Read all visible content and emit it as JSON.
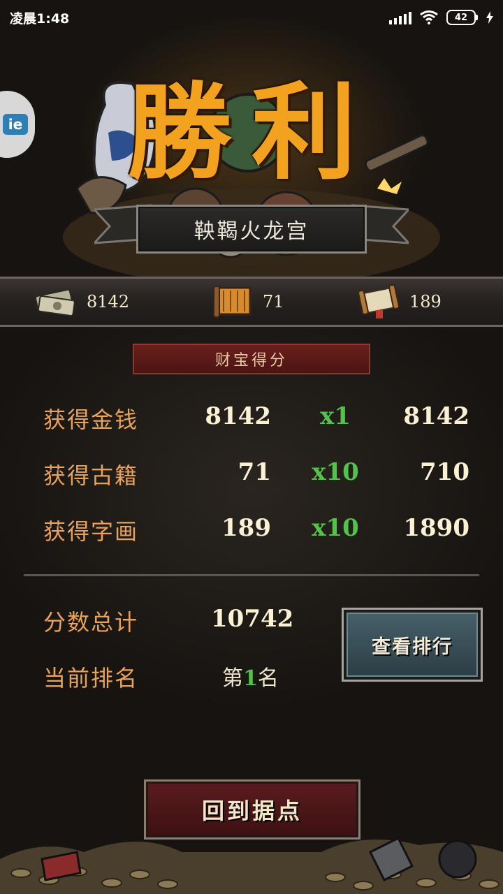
{
  "status_bar": {
    "time": "凌晨1:48",
    "battery": "42"
  },
  "side_float": {
    "glyph": "ie"
  },
  "header": {
    "title": "勝利",
    "stage_name": "鞅鞨火龙宫"
  },
  "resources": [
    {
      "icon": "money-icon",
      "value": "8142"
    },
    {
      "icon": "book-icon",
      "value": "71"
    },
    {
      "icon": "scroll-icon",
      "value": "189"
    }
  ],
  "section": {
    "title": "财宝得分"
  },
  "scores": [
    {
      "label": "获得金钱",
      "count": "8142",
      "multiplier": "x1",
      "result": "8142"
    },
    {
      "label": "获得古籍",
      "count": "71",
      "multiplier": "x10",
      "result": "710"
    },
    {
      "label": "获得字画",
      "count": "189",
      "multiplier": "x10",
      "result": "1890"
    }
  ],
  "summary": {
    "total_label": "分数总计",
    "total_value": "10742",
    "rank_label": "当前排名",
    "rank_prefix": "第",
    "rank_number": "1",
    "rank_suffix": "名"
  },
  "buttons": {
    "view_rank": "查看排行",
    "return_base": "回到据点"
  },
  "colors": {
    "title": "#f3a21f",
    "label": "#e9a25a",
    "multiplier": "#52c24a",
    "value": "#fbf2d5"
  }
}
